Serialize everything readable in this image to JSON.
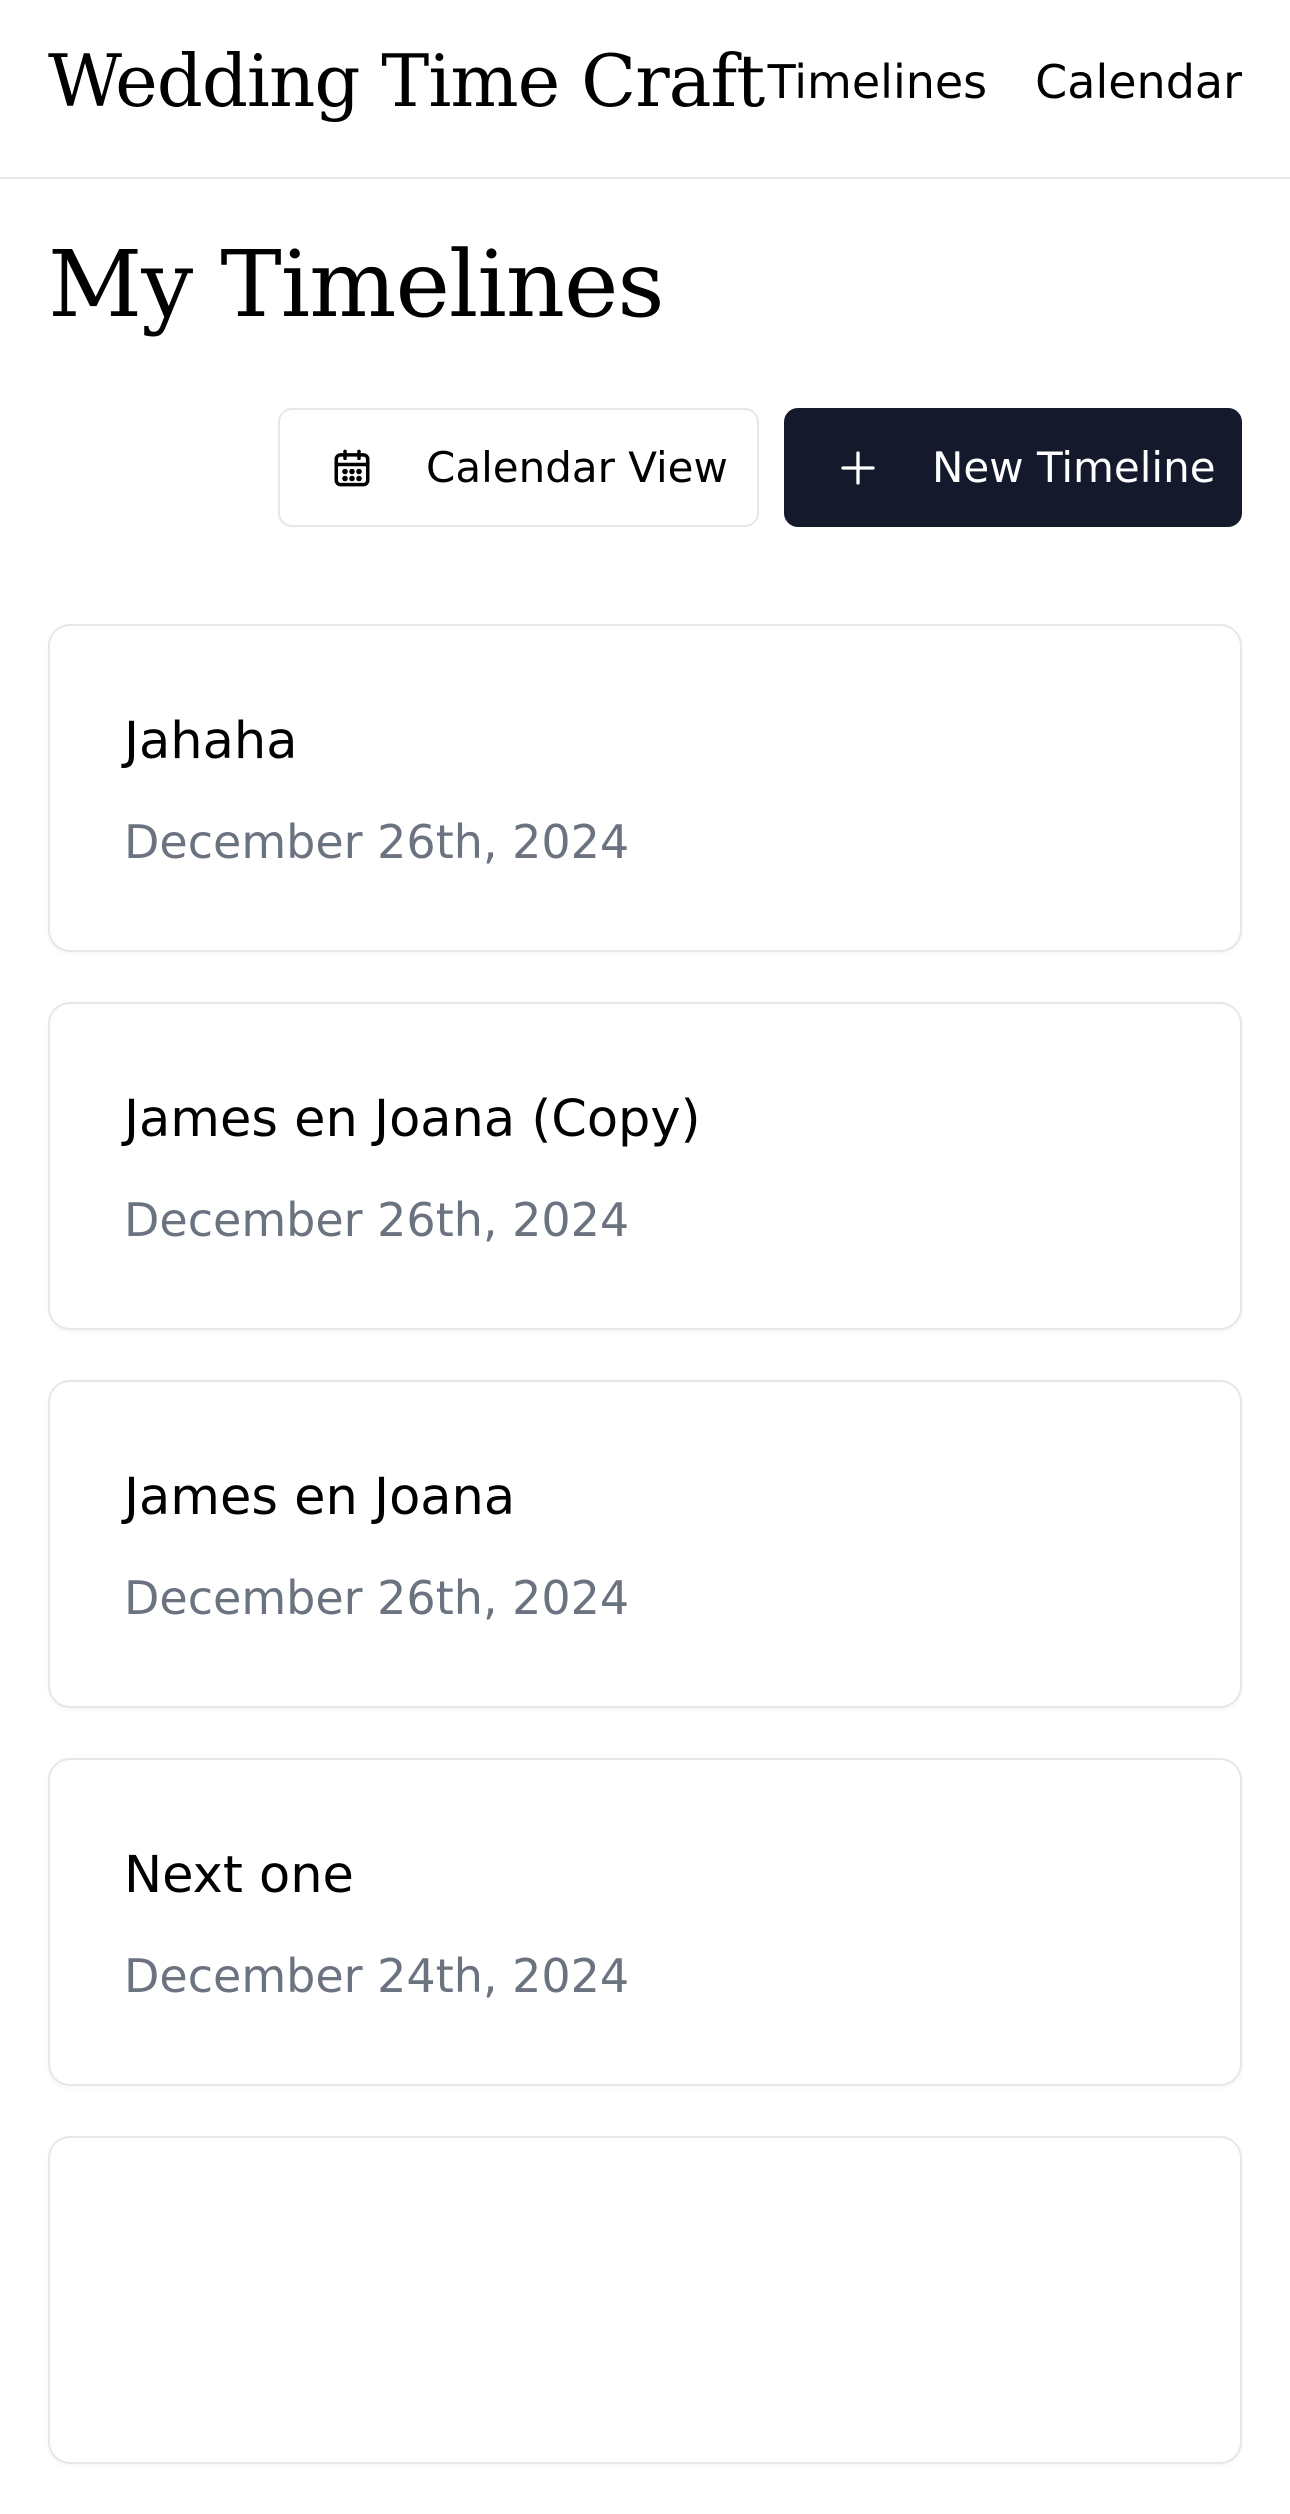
{
  "header": {
    "brand": "Wedding Time Craft",
    "nav": [
      "Timelines",
      "Calendar"
    ]
  },
  "page": {
    "title": "My Timelines"
  },
  "actions": {
    "calendar_view_label": "Calendar View",
    "calendar_view_icon": "calendar-icon",
    "new_timeline_label": "New Timeline",
    "new_timeline_icon": "plus-icon"
  },
  "timelines": [
    {
      "title": "Jahaha",
      "date": "December 26th, 2024"
    },
    {
      "title": "James en Joana (Copy)",
      "date": "December 26th, 2024"
    },
    {
      "title": "James en Joana",
      "date": "December 26th, 2024"
    },
    {
      "title": "Next one",
      "date": "December 24th, 2024"
    },
    {
      "title": "",
      "date": ""
    }
  ],
  "colors": {
    "primary": "#141a2b",
    "muted_text": "#6b7280",
    "border": "#e5e7eb"
  }
}
